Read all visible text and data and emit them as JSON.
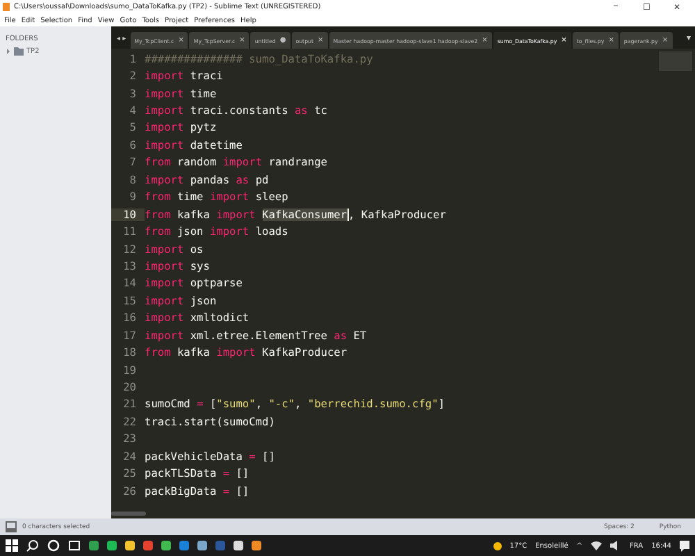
{
  "window": {
    "title": "C:\\Users\\oussal\\Downloads\\sumo_DataToKafka.py (TP2) - Sublime Text (UNREGISTERED)",
    "controls": [
      "−",
      "☐",
      "✕"
    ]
  },
  "menu": [
    "File",
    "Edit",
    "Selection",
    "Find",
    "View",
    "Goto",
    "Tools",
    "Project",
    "Preferences",
    "Help"
  ],
  "sidebar": {
    "heading": "FOLDERS",
    "items": [
      {
        "label": "TP2",
        "expanded": false
      }
    ]
  },
  "tab_nav": "◂ ▸",
  "tabs": [
    {
      "label": "My_TcpClient.c",
      "selected": false,
      "dirty": false
    },
    {
      "label": "My_TcpServer.c",
      "selected": false,
      "dirty": false
    },
    {
      "label": "untitled",
      "selected": false,
      "dirty": true
    },
    {
      "label": "output",
      "selected": false,
      "dirty": false
    },
    {
      "label": "Master hadoop-master hadoop-slave1 hadoop-slave2",
      "selected": false,
      "dirty": false
    },
    {
      "label": "sumo_DataToKafka.py",
      "selected": true,
      "dirty": false
    },
    {
      "label": "to_files.py",
      "selected": false,
      "dirty": false
    },
    {
      "label": "pagerank.py",
      "selected": false,
      "dirty": false
    }
  ],
  "tab_close": "×",
  "tab_dirty": "●",
  "tab_menu": "▾",
  "lines": [
    {
      "num": "1",
      "current": false,
      "tokens": [
        {
          "kind": "comment",
          "text": "############### sumo_DataToKafka.py"
        }
      ]
    },
    {
      "num": "2",
      "current": false,
      "tokens": [
        {
          "kind": "kw",
          "text": "import"
        },
        {
          "kind": "plain",
          "text": " traci"
        }
      ]
    },
    {
      "num": "3",
      "current": false,
      "tokens": [
        {
          "kind": "kw",
          "text": "import"
        },
        {
          "kind": "plain",
          "text": " time"
        }
      ]
    },
    {
      "num": "4",
      "current": false,
      "tokens": [
        {
          "kind": "kw",
          "text": "import"
        },
        {
          "kind": "plain",
          "text": " traci.constants "
        },
        {
          "kind": "kw",
          "text": "as"
        },
        {
          "kind": "plain",
          "text": " tc"
        }
      ]
    },
    {
      "num": "5",
      "current": false,
      "tokens": [
        {
          "kind": "kw",
          "text": "import"
        },
        {
          "kind": "plain",
          "text": " pytz"
        }
      ]
    },
    {
      "num": "6",
      "current": false,
      "tokens": [
        {
          "kind": "kw",
          "text": "import"
        },
        {
          "kind": "plain",
          "text": " datetime"
        }
      ]
    },
    {
      "num": "7",
      "current": false,
      "tokens": [
        {
          "kind": "kw",
          "text": "from"
        },
        {
          "kind": "plain",
          "text": " random "
        },
        {
          "kind": "kw",
          "text": "import"
        },
        {
          "kind": "plain",
          "text": " randrange"
        }
      ]
    },
    {
      "num": "8",
      "current": false,
      "tokens": [
        {
          "kind": "kw",
          "text": "import"
        },
        {
          "kind": "plain",
          "text": " pandas "
        },
        {
          "kind": "kw",
          "text": "as"
        },
        {
          "kind": "plain",
          "text": " pd"
        }
      ]
    },
    {
      "num": "9",
      "current": false,
      "tokens": [
        {
          "kind": "kw",
          "text": "from"
        },
        {
          "kind": "plain",
          "text": " time "
        },
        {
          "kind": "kw",
          "text": "import"
        },
        {
          "kind": "plain",
          "text": " sleep"
        }
      ]
    },
    {
      "num": "10",
      "current": true,
      "tokens": [
        {
          "kind": "kw",
          "text": "from"
        },
        {
          "kind": "plain",
          "text": " kafka "
        },
        {
          "kind": "kw",
          "text": "import "
        },
        {
          "kind": "match",
          "text": "KafkaConsumer"
        },
        {
          "kind": "plain",
          "text": ", KafkaProducer"
        }
      ]
    },
    {
      "num": "11",
      "current": false,
      "tokens": [
        {
          "kind": "kw",
          "text": "from"
        },
        {
          "kind": "plain",
          "text": " json "
        },
        {
          "kind": "kw",
          "text": "import"
        },
        {
          "kind": "plain",
          "text": " loads"
        }
      ]
    },
    {
      "num": "12",
      "current": false,
      "tokens": [
        {
          "kind": "kw",
          "text": "import"
        },
        {
          "kind": "plain",
          "text": " os"
        }
      ]
    },
    {
      "num": "13",
      "current": false,
      "tokens": [
        {
          "kind": "kw",
          "text": "import"
        },
        {
          "kind": "plain",
          "text": " sys"
        }
      ]
    },
    {
      "num": "14",
      "current": false,
      "tokens": [
        {
          "kind": "kw",
          "text": "import"
        },
        {
          "kind": "plain",
          "text": " optparse"
        }
      ]
    },
    {
      "num": "15",
      "current": false,
      "tokens": [
        {
          "kind": "kw",
          "text": "import"
        },
        {
          "kind": "plain",
          "text": " json"
        }
      ]
    },
    {
      "num": "16",
      "current": false,
      "tokens": [
        {
          "kind": "kw",
          "text": "import"
        },
        {
          "kind": "plain",
          "text": " xmltodict"
        }
      ]
    },
    {
      "num": "17",
      "current": false,
      "tokens": [
        {
          "kind": "kw",
          "text": "import"
        },
        {
          "kind": "plain",
          "text": " xml.etree.ElementTree "
        },
        {
          "kind": "kw",
          "text": "as"
        },
        {
          "kind": "plain",
          "text": " ET"
        }
      ]
    },
    {
      "num": "18",
      "current": false,
      "tokens": [
        {
          "kind": "kw",
          "text": "from"
        },
        {
          "kind": "plain",
          "text": " kafka "
        },
        {
          "kind": "kw",
          "text": "import"
        },
        {
          "kind": "plain",
          "text": " KafkaProducer"
        }
      ]
    },
    {
      "num": "19",
      "current": false
    },
    {
      "num": "20",
      "current": false
    },
    {
      "num": "21",
      "current": false,
      "tokens": [
        {
          "kind": "plain",
          "text": "sumoCmd "
        },
        {
          "kind": "kw",
          "text": "="
        },
        {
          "kind": "plain",
          "text": " ["
        },
        {
          "kind": "str",
          "text": "\"sumo\""
        },
        {
          "kind": "plain",
          "text": ", "
        },
        {
          "kind": "str",
          "text": "\"-c\""
        },
        {
          "kind": "plain",
          "text": ", "
        },
        {
          "kind": "str",
          "text": "\"berrechid.sumo.cfg\""
        },
        {
          "kind": "plain",
          "text": "]"
        }
      ]
    },
    {
      "num": "22",
      "current": false,
      "tokens": [
        {
          "kind": "plain",
          "text": "traci.start(sumoCmd)"
        }
      ]
    },
    {
      "num": "23",
      "current": false
    },
    {
      "num": "24",
      "current": false,
      "tokens": [
        {
          "kind": "plain",
          "text": "packVehicleData "
        },
        {
          "kind": "kw",
          "text": "="
        },
        {
          "kind": "plain",
          "text": " []"
        }
      ]
    },
    {
      "num": "25",
      "current": false,
      "tokens": [
        {
          "kind": "plain",
          "text": "packTLSData "
        },
        {
          "kind": "kw",
          "text": "="
        },
        {
          "kind": "plain",
          "text": " []"
        }
      ]
    },
    {
      "num": "26",
      "current": false,
      "tokens": [
        {
          "kind": "plain",
          "text": "packBigData "
        },
        {
          "kind": "kw",
          "text": "="
        },
        {
          "kind": "plain",
          "text": " []"
        }
      ]
    }
  ],
  "status_bar": {
    "message": "0 characters selected",
    "indent": "Spaces: 2",
    "syntax": "Python"
  },
  "taskbar": {
    "apps": [
      {
        "kind": "search"
      },
      {
        "kind": "task"
      },
      {
        "kind": "view"
      },
      {
        "kind": "app",
        "color": "#2e9e4f"
      },
      {
        "kind": "app",
        "color": "#1db954"
      },
      {
        "kind": "app",
        "color": "#f2c12e"
      },
      {
        "kind": "app",
        "color": "#e5412f"
      },
      {
        "kind": "app",
        "color": "#3fb950"
      },
      {
        "kind": "app",
        "color": "#1a7fd6"
      },
      {
        "kind": "app",
        "color": "#7aa6c9"
      },
      {
        "kind": "app",
        "color": "#2b579a"
      },
      {
        "kind": "app",
        "color": "#dddddd"
      },
      {
        "kind": "app",
        "color": "#f08a24"
      }
    ],
    "weather": "17°C",
    "weather_text": "Ensoleillé",
    "tray": "^",
    "lang": "FRA",
    "time": "16:44"
  }
}
